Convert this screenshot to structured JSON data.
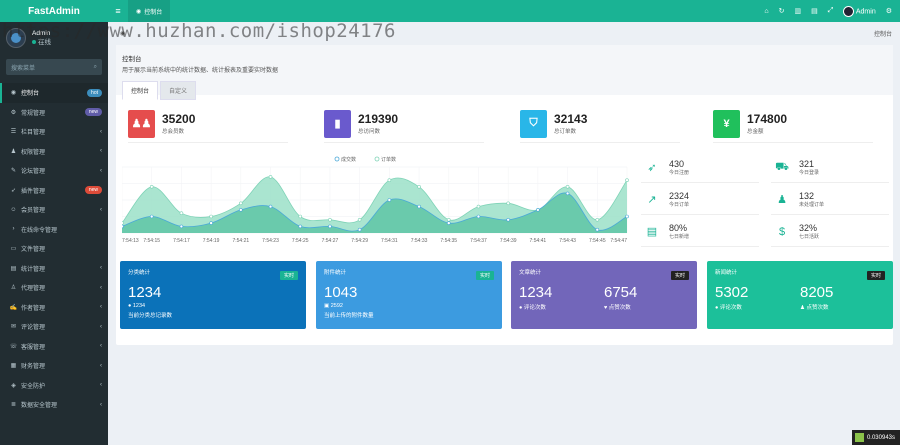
{
  "app": {
    "title": "FastAdmin"
  },
  "user": {
    "name": "Admin",
    "status": "在线"
  },
  "search": {
    "placeholder": "搜索菜单"
  },
  "sidebar": {
    "items": [
      {
        "label": "控制台",
        "icon": "dashboard-icon",
        "glyph": "◉",
        "badge": "hot",
        "badge_color": "#3c8dbc",
        "active": true
      },
      {
        "label": "常规管理",
        "icon": "cogs-icon",
        "glyph": "⚙",
        "badge": "new",
        "badge_color": "#605ca8"
      },
      {
        "label": "栏目管理",
        "icon": "list-icon",
        "glyph": "☰",
        "arrow": "‹"
      },
      {
        "label": "权限管理",
        "icon": "group-icon",
        "glyph": "♟",
        "arrow": "‹"
      },
      {
        "label": "论坛管理",
        "icon": "forum-icon",
        "glyph": "✎",
        "arrow": "‹"
      },
      {
        "label": "插件管理",
        "icon": "rocket-icon",
        "glyph": "➶",
        "badge": "new",
        "badge_color": "#dd4b39"
      },
      {
        "label": "会员管理",
        "icon": "user-icon",
        "glyph": "☺",
        "arrow": "‹"
      },
      {
        "label": "在线命令管理",
        "icon": "terminal-icon",
        "glyph": "›"
      },
      {
        "label": "文件管理",
        "icon": "folder-icon",
        "glyph": "▭"
      },
      {
        "label": "统计管理",
        "icon": "bar-chart-icon",
        "glyph": "▤",
        "arrow": "‹"
      },
      {
        "label": "代理管理",
        "icon": "agent-icon",
        "glyph": "♙",
        "arrow": "‹"
      },
      {
        "label": "作者管理",
        "icon": "author-icon",
        "glyph": "✍",
        "arrow": "‹"
      },
      {
        "label": "评论管理",
        "icon": "comment-icon",
        "glyph": "✉",
        "arrow": "‹"
      },
      {
        "label": "客服管理",
        "icon": "headset-icon",
        "glyph": "☏",
        "arrow": "‹"
      },
      {
        "label": "财务管理",
        "icon": "finance-icon",
        "glyph": "▦",
        "arrow": "‹"
      },
      {
        "label": "安全防护",
        "icon": "shield-icon",
        "glyph": "◈",
        "arrow": "‹"
      },
      {
        "label": "数据安全管理",
        "icon": "database-icon",
        "glyph": "≣",
        "arrow": "‹"
      }
    ]
  },
  "topbar": {
    "tab_label": "控制台"
  },
  "breadcrumb": {
    "right": "控制台"
  },
  "panel": {
    "title": "控制台",
    "desc": "用于展示当前系统中的统计数据、统计报表及重要实时数据",
    "tabs": [
      "控制台",
      "自定义"
    ]
  },
  "stats": [
    {
      "value": "35200",
      "label": "总会员数",
      "color": "#e54d4d",
      "icon": "users-icon",
      "glyph": "♟♟"
    },
    {
      "value": "219390",
      "label": "总访问数",
      "color": "#6a5acd",
      "icon": "book-icon",
      "glyph": "▮"
    },
    {
      "value": "32143",
      "label": "总订单数",
      "color": "#29b6e8",
      "icon": "shopping-bag-icon",
      "glyph": "⛉"
    },
    {
      "value": "174800",
      "label": "总金额",
      "color": "#20c05c",
      "icon": "yen-icon",
      "glyph": "¥"
    }
  ],
  "quick": [
    {
      "value": "430",
      "label": "今日注册",
      "icon": "rocket-icon",
      "glyph": "➶"
    },
    {
      "value": "321",
      "label": "今日登录",
      "icon": "cart-icon",
      "glyph": "⛟"
    },
    {
      "value": "2324",
      "label": "今日订单",
      "icon": "area-chart-icon",
      "glyph": "↗"
    },
    {
      "value": "132",
      "label": "未处理订单",
      "icon": "users-icon",
      "glyph": "♟"
    },
    {
      "value": "80%",
      "label": "七日新增",
      "icon": "calendar-icon",
      "glyph": "▤"
    },
    {
      "value": "32%",
      "label": "七日活跃",
      "icon": "dollar-icon",
      "glyph": "$"
    }
  ],
  "panels": [
    {
      "title": "分类统计",
      "badge": "实时",
      "big": "1234",
      "line1": "1234",
      "line1_icon": "comment-icon",
      "line1_glyph": "●",
      "line2": "当前分类总记录数",
      "color": "#0b72b9"
    },
    {
      "title": "附件统计",
      "badge": "实时",
      "big": "1043",
      "line1": "2592",
      "line1_icon": "image-icon",
      "line1_glyph": "▣",
      "line2": "当前上传的附件数量",
      "color": "#3c9be0"
    },
    {
      "title": "文章统计",
      "badge": "实时",
      "a_big": "1234",
      "a_label": "评论次数",
      "a_icon": "comment-icon",
      "a_glyph": "●",
      "b_big": "6754",
      "b_label": "点赞次数",
      "b_icon": "heart-icon",
      "b_glyph": "♥",
      "color": "#7266ba"
    },
    {
      "title": "新闻统计",
      "badge": "实时",
      "a_big": "5302",
      "a_label": "评论次数",
      "a_icon": "comment-icon",
      "a_glyph": "●",
      "b_big": "8205",
      "b_label": "点赞次数",
      "b_icon": "user-icon",
      "b_glyph": "♟",
      "color": "#1cc09a"
    }
  ],
  "watermark": {
    "text": "https://www.huzhan.com/ishop24176"
  },
  "perf": {
    "text": "0.030943s"
  },
  "chart_data": {
    "type": "area",
    "legend": [
      "成交数",
      "订单数"
    ],
    "legend_position": "top",
    "grid": true,
    "x": [
      "7:54:13",
      "7:54:15",
      "7:54:17",
      "7:54:19",
      "7:54:21",
      "7:54:23",
      "7:54:25",
      "7:54:27",
      "7:54:29",
      "7:54:31",
      "7:54:33",
      "7:54:35",
      "7:54:37",
      "7:54:39",
      "7:54:41",
      "7:54:43",
      "7:54:45",
      "7:54:47"
    ],
    "x_tick_labels": [
      "7:54:13",
      "7:54:15",
      "7:54:17",
      "7:54:19",
      "7:54:21",
      "7:54:23",
      "7:54:25",
      "7:54:27",
      "7:54:29",
      "7:54:31",
      "7:54:33",
      "7:54:35",
      "7:54:37",
      "7:54:39",
      "7:54:41",
      "7:54:43",
      "7:54:45",
      "7:54:47"
    ],
    "series": [
      {
        "name": "订单数",
        "color": "#9be0c8",
        "values": [
          15,
          70,
          30,
          25,
          45,
          85,
          25,
          20,
          20,
          80,
          70,
          20,
          40,
          45,
          35,
          70,
          20,
          80
        ]
      },
      {
        "name": "成交数",
        "color": "#5fc6a6",
        "values": [
          10,
          25,
          10,
          15,
          35,
          40,
          10,
          10,
          5,
          50,
          40,
          15,
          25,
          20,
          35,
          60,
          5,
          25
        ]
      }
    ],
    "ylim": [
      0,
      100
    ]
  }
}
